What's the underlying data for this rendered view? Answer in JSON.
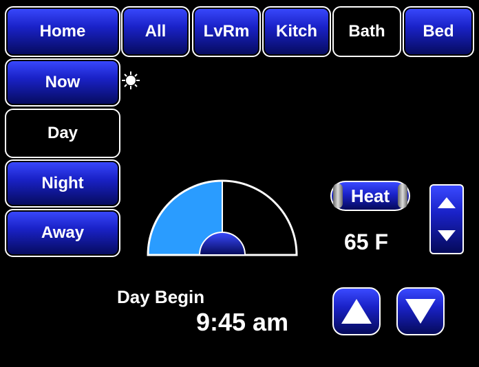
{
  "nav": {
    "home": "Home",
    "rooms": [
      "All",
      "LvRm",
      "Kitch",
      "Bath",
      "Bed"
    ],
    "selected_room": "Bath"
  },
  "modes": {
    "items": [
      "Now",
      "Day",
      "Night",
      "Away"
    ],
    "selected": "Day"
  },
  "weather_icon": "sun-icon",
  "hvac": {
    "mode_label": "Heat",
    "setpoint": "65 F"
  },
  "schedule": {
    "label": "Day Begin",
    "time": "9:45 am"
  },
  "colors": {
    "button_blue": "#1a22c8",
    "dial_fill": "#2a9cff",
    "selected_bg": "#000000"
  }
}
